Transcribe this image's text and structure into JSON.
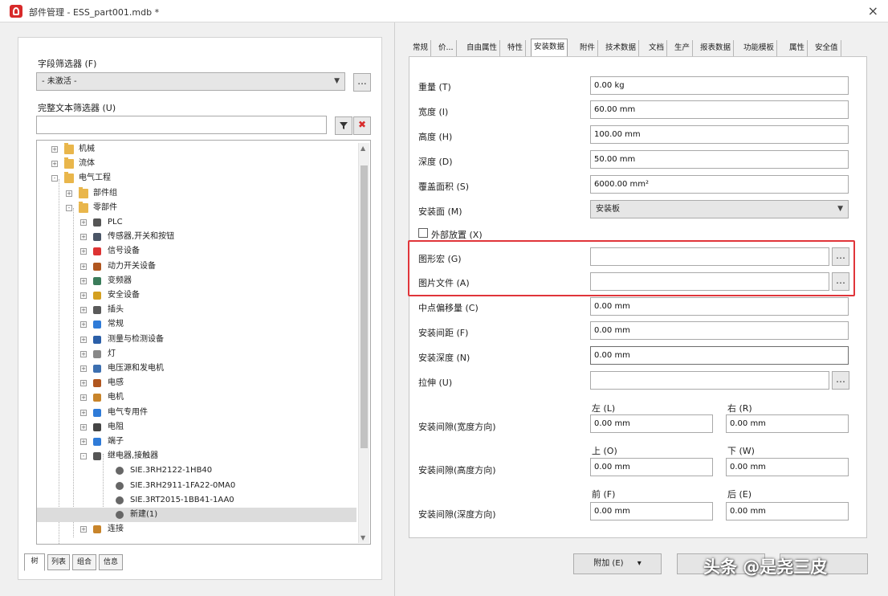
{
  "window": {
    "title": "部件管理 - ESS_part001.mdb *",
    "close": "×"
  },
  "left": {
    "field_filter_label": "字段筛选器 (F)",
    "field_filter_value": "- 未激活 -",
    "field_filter_btn": "...",
    "fulltext_label": "完整文本筛选器 (U)",
    "fulltext_value": "",
    "tree": [
      {
        "label": "机械",
        "level": 0,
        "exp": "+",
        "icon": "folder-icon"
      },
      {
        "label": "流体",
        "level": 0,
        "exp": "+",
        "icon": "folder-icon"
      },
      {
        "label": "电气工程",
        "level": 0,
        "exp": "-",
        "icon": "folder-icon"
      },
      {
        "label": "部件组",
        "level": 1,
        "exp": "+",
        "icon": "folder-icon"
      },
      {
        "label": "零部件",
        "level": 1,
        "exp": "-",
        "icon": "folder-icon"
      },
      {
        "label": "PLC",
        "level": 2,
        "exp": "+",
        "icon": "plc-icon"
      },
      {
        "label": "传感器,开关和按钮",
        "level": 2,
        "exp": "+",
        "icon": "sensor-icon"
      },
      {
        "label": "信号设备",
        "level": 2,
        "exp": "+",
        "icon": "signal-icon"
      },
      {
        "label": "动力开关设备",
        "level": 2,
        "exp": "+",
        "icon": "power-switch-icon"
      },
      {
        "label": "变频器",
        "level": 2,
        "exp": "+",
        "icon": "inverter-icon"
      },
      {
        "label": "安全设备",
        "level": 2,
        "exp": "+",
        "icon": "safety-icon"
      },
      {
        "label": "插头",
        "level": 2,
        "exp": "+",
        "icon": "plug-icon"
      },
      {
        "label": "常规",
        "level": 2,
        "exp": "+",
        "icon": "general-icon"
      },
      {
        "label": "测量与检测设备",
        "level": 2,
        "exp": "+",
        "icon": "measure-icon"
      },
      {
        "label": "灯",
        "level": 2,
        "exp": "+",
        "icon": "lamp-icon"
      },
      {
        "label": "电压源和发电机",
        "level": 2,
        "exp": "+",
        "icon": "voltage-source-icon"
      },
      {
        "label": "电感",
        "level": 2,
        "exp": "+",
        "icon": "inductor-icon"
      },
      {
        "label": "电机",
        "level": 2,
        "exp": "+",
        "icon": "motor-icon"
      },
      {
        "label": "电气专用件",
        "level": 2,
        "exp": "+",
        "icon": "electrical-special-icon"
      },
      {
        "label": "电阻",
        "level": 2,
        "exp": "+",
        "icon": "resistor-icon"
      },
      {
        "label": "端子",
        "level": 2,
        "exp": "+",
        "icon": "terminal-icon"
      },
      {
        "label": "继电器,接触器",
        "level": 2,
        "exp": "-",
        "icon": "relay-icon"
      },
      {
        "label": "SIE.3RH2122-1HB40",
        "level": 3,
        "exp": "",
        "icon": "component-icon"
      },
      {
        "label": "SIE.3RH2911-1FA22-0MA0",
        "level": 3,
        "exp": "",
        "icon": "component-icon"
      },
      {
        "label": "SIE.3RT2015-1BB41-1AA0",
        "level": 3,
        "exp": "",
        "icon": "component-icon"
      },
      {
        "label": "新建(1)",
        "level": 3,
        "exp": "",
        "icon": "component-icon",
        "selected": true
      },
      {
        "label": "连接",
        "level": 2,
        "exp": "+",
        "icon": "connection-icon"
      }
    ],
    "bottom_tabs": [
      "树",
      "列表",
      "组合",
      "信息"
    ]
  },
  "right": {
    "tabs": [
      "常规",
      "价...",
      "自由属性",
      "特性",
      "安装数据",
      "附件",
      "技术数据",
      "文档",
      "生产",
      "报表数据",
      "功能模板",
      "属性",
      "安全值"
    ],
    "active_tab": 4,
    "fields": {
      "weight": {
        "label": "重量 (T)",
        "value": "0.00 kg"
      },
      "width": {
        "label": "宽度 (I)",
        "value": "60.00 mm"
      },
      "height": {
        "label": "高度 (H)",
        "value": "100.00 mm"
      },
      "depth": {
        "label": "深度 (D)",
        "value": "50.00 mm"
      },
      "area": {
        "label": "覆盖面积 (S)",
        "value": "6000.00 mm²"
      },
      "mount": {
        "label": "安装面 (M)",
        "value": "安装板"
      },
      "external": {
        "label": "外部放置 (X)"
      },
      "graphic_macro": {
        "label": "图形宏 (G)",
        "value": ""
      },
      "image_file": {
        "label": "图片文件 (A)",
        "value": ""
      },
      "center_offset": {
        "label": "中点偏移量 (C)",
        "value": "0.00 mm"
      },
      "mount_spacing": {
        "label": "安装间距 (F)",
        "value": "0.00 mm"
      },
      "mount_depth": {
        "label": "安装深度 (N)",
        "value": "0.00 mm"
      },
      "shape": {
        "label": "拉伸 (U)",
        "value": ""
      }
    },
    "spacing_width": {
      "label": "安装间隙(宽度方向)",
      "left_label": "左 (L)",
      "right_label": "右 (R)",
      "left": "0.00 mm",
      "right": "0.00 mm"
    },
    "spacing_height": {
      "label": "安装间隙(高度方向)",
      "top_label": "上 (O)",
      "bottom_label": "下 (W)",
      "top": "0.00 mm",
      "bottom": "0.00 mm"
    },
    "spacing_depth": {
      "label": "安装间隙(深度方向)",
      "front_label": "前 (F)",
      "back_label": "后 (E)",
      "front": "0.00 mm",
      "back": "0.00 mm"
    },
    "buttons": {
      "extra": "附加 (E)",
      "dropdown": "▾"
    }
  },
  "watermark": "头条 @是尧三皮",
  "colors": {
    "highlight": "#e0353a",
    "folder": "#e9b64b",
    "accent": "#d82a2a"
  }
}
